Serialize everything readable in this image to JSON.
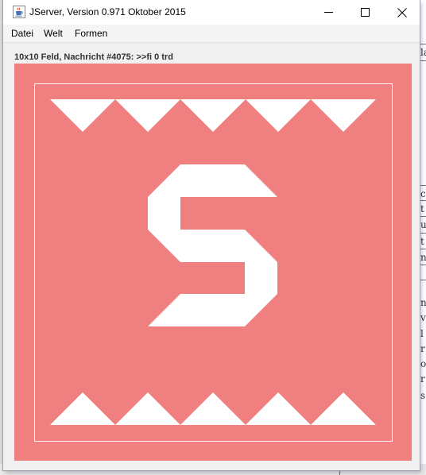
{
  "window": {
    "title": "JServer, Version 0.971 Oktober 2015"
  },
  "menu": [
    {
      "label": "Datei"
    },
    {
      "label": "Welt"
    },
    {
      "label": "Formen"
    }
  ],
  "status": "10x10 Feld, Nachricht #4075: >>fi 0 trd",
  "board": {
    "background_color": "#f08080",
    "symbol_color": "#ffffff",
    "symbol": "S"
  },
  "background_fragments": {
    "glyphs": [
      "la",
      "c",
      "t",
      "u",
      "t",
      "n",
      "n",
      "v",
      "l",
      "r",
      "o",
      "r",
      "s"
    ]
  },
  "icons": {
    "app": "java-cup-icon",
    "minimize": "minimize-icon",
    "maximize": "maximize-icon",
    "close": "close-icon"
  }
}
